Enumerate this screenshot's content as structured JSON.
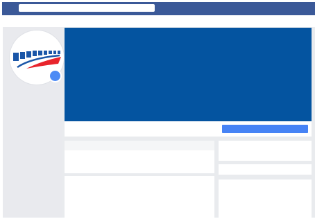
{
  "colors": {
    "topbar": "#3b5998",
    "cover": "#0454a0",
    "action_button": "#4683f5",
    "online_indicator": "#4c8bf5",
    "logo_blue": "#1a56a8",
    "logo_red": "#e8242c"
  },
  "header": {
    "search": {
      "value": "",
      "placeholder": ""
    }
  },
  "profile": {
    "avatar_icon": "transit-logo-icon",
    "status_icon": "online-status-icon"
  },
  "actions": {
    "primary_button_label": ""
  }
}
